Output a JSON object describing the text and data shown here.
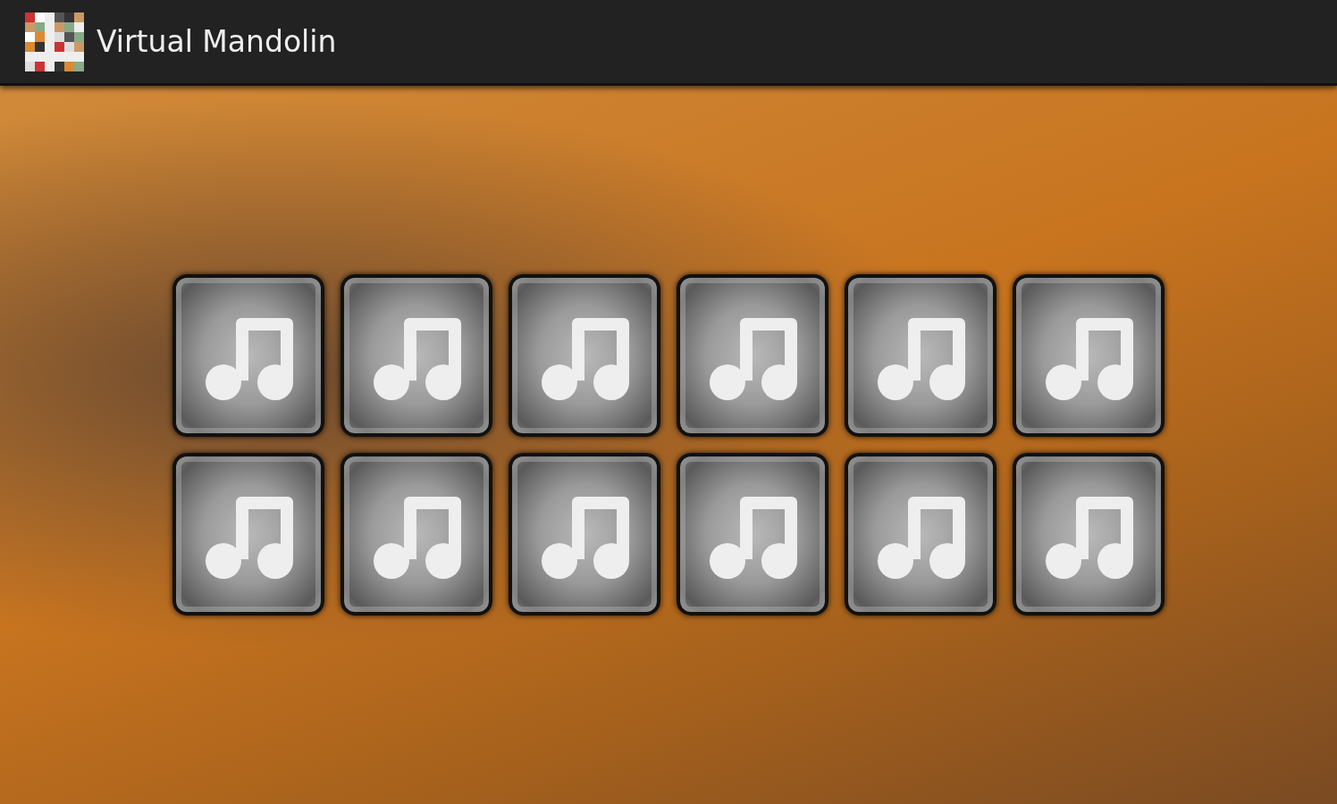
{
  "app_bar": {
    "title": "Virtual Mandolin"
  },
  "sound_pads": [
    [
      {
        "kind": "note"
      },
      {
        "kind": "note"
      },
      {
        "kind": "note"
      },
      {
        "kind": "note"
      },
      {
        "kind": "note"
      },
      {
        "kind": "note"
      }
    ],
    [
      {
        "kind": "note"
      },
      {
        "kind": "note"
      },
      {
        "kind": "note"
      },
      {
        "kind": "note"
      },
      {
        "kind": "note"
      },
      {
        "kind": "note"
      }
    ]
  ]
}
